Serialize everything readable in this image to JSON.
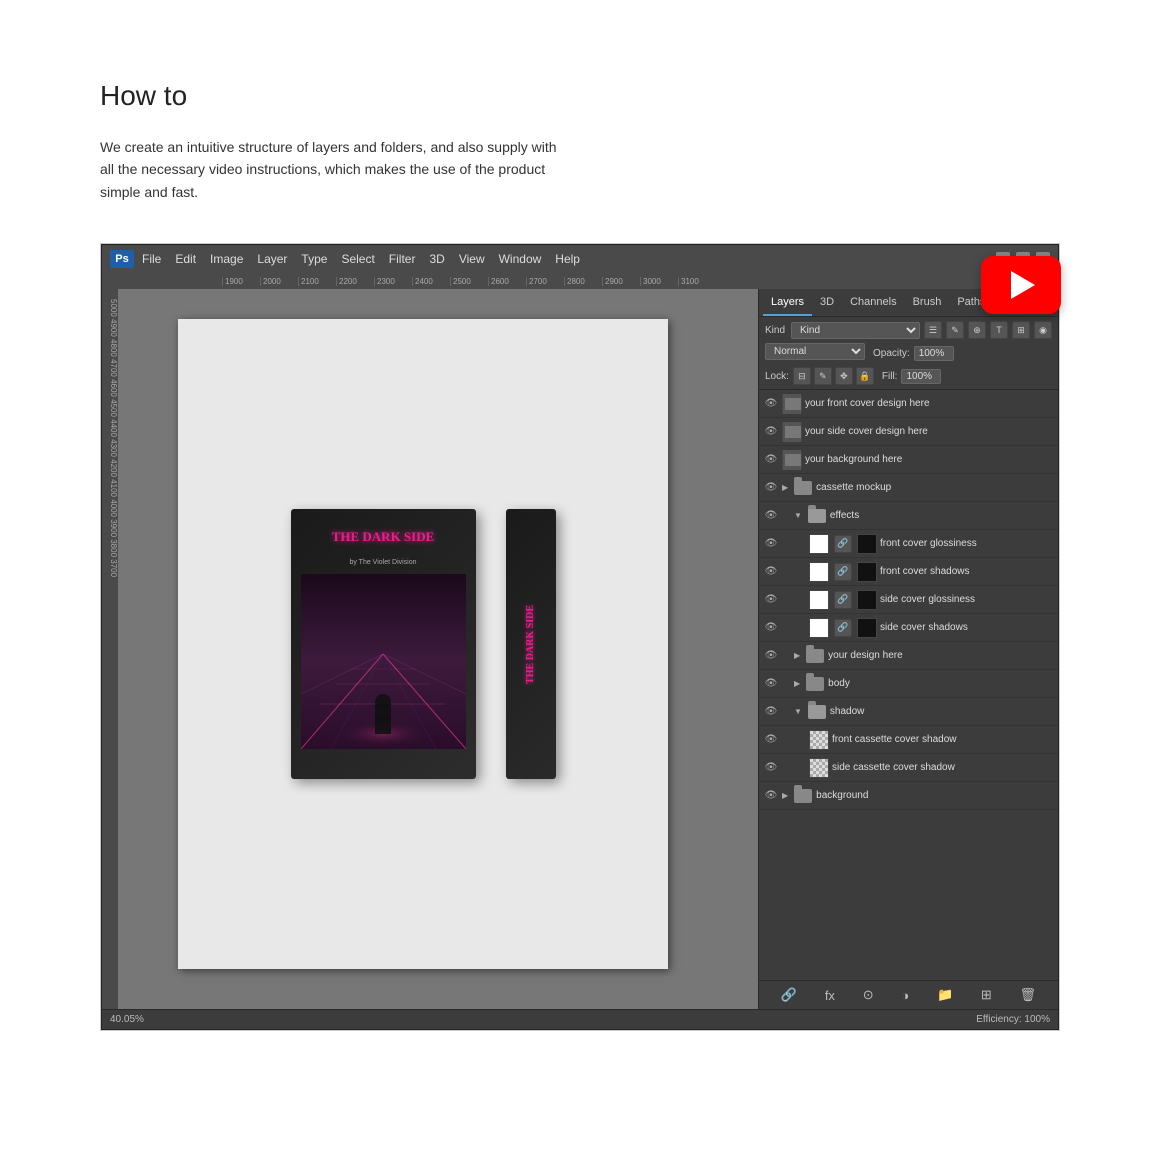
{
  "page": {
    "title": "How to",
    "description_line1": "We create an intuitive structure of layers and folders, and also supply with",
    "description_line2": "all the necessary video instructions, which makes the use of the product",
    "description_line3": "simple and fast."
  },
  "ps": {
    "logo": "Ps",
    "menu": [
      "File",
      "Edit",
      "Image",
      "Layer",
      "Type",
      "Select",
      "Filter",
      "3D",
      "View",
      "Window",
      "Help"
    ],
    "ruler_nums": [
      "1900",
      "2000",
      "2100",
      "2200",
      "2300",
      "2400",
      "2500",
      "2600",
      "2700",
      "2800",
      "2900",
      "3000",
      "3100"
    ],
    "status": "40.05%",
    "efficiency": "Efficiency: 100%"
  },
  "panels": {
    "tabs": [
      "Layers",
      "3D",
      "Channels",
      "Brush",
      "Paths"
    ],
    "active_tab": "Layers",
    "kind_label": "Kind",
    "normal_label": "Normal",
    "opacity_label": "Opacity:",
    "opacity_value": "100%",
    "fill_label": "Fill:",
    "fill_value": "100%",
    "lock_label": "Lock:",
    "layers": [
      {
        "id": "layer1",
        "indent": 0,
        "type": "layer",
        "name": "your front cover design here",
        "eye": true
      },
      {
        "id": "layer2",
        "indent": 0,
        "type": "layer",
        "name": "your side cover design here",
        "eye": true
      },
      {
        "id": "layer3",
        "indent": 0,
        "type": "layer",
        "name": "your background here",
        "eye": true
      },
      {
        "id": "layer4",
        "indent": 0,
        "type": "folder_closed",
        "name": "cassette mockup",
        "eye": true
      },
      {
        "id": "layer5",
        "indent": 1,
        "type": "folder_open",
        "name": "effects",
        "eye": true
      },
      {
        "id": "layer6",
        "indent": 2,
        "type": "layer",
        "name": "front cover glossiness",
        "eye": true
      },
      {
        "id": "layer7",
        "indent": 2,
        "type": "layer",
        "name": "front cover shadows",
        "eye": true
      },
      {
        "id": "layer8",
        "indent": 2,
        "type": "layer",
        "name": "side cover glossiness",
        "eye": true
      },
      {
        "id": "layer9",
        "indent": 2,
        "type": "layer",
        "name": "side cover shadows",
        "eye": true
      },
      {
        "id": "layer10",
        "indent": 1,
        "type": "folder_closed",
        "name": "your design here",
        "eye": true
      },
      {
        "id": "layer11",
        "indent": 1,
        "type": "folder_closed",
        "name": "body",
        "eye": true
      },
      {
        "id": "layer12",
        "indent": 1,
        "type": "folder_open",
        "name": "shadow",
        "eye": true
      },
      {
        "id": "layer13",
        "indent": 2,
        "type": "layer_checker",
        "name": "front cassette cover shadow",
        "eye": true
      },
      {
        "id": "layer14",
        "indent": 2,
        "type": "layer_checker",
        "name": "side cassette cover shadow",
        "eye": true
      },
      {
        "id": "layer15",
        "indent": 0,
        "type": "folder_closed",
        "name": "background",
        "eye": true
      }
    ]
  },
  "cassette": {
    "title": "THE DARK SIDE",
    "subtitle": "by The Violet Division",
    "side_text": "THE DARK SIDE"
  }
}
